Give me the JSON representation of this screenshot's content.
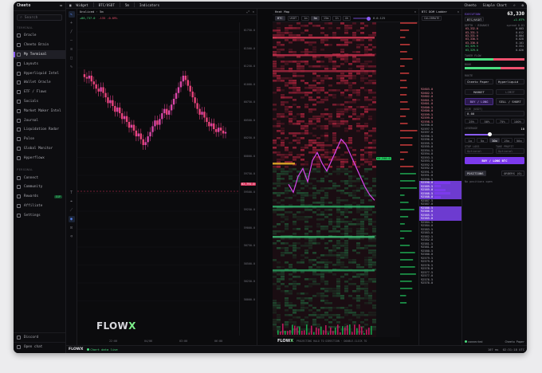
{
  "app": {
    "brand": "Cheeto",
    "status_brand": "FLOWX",
    "status_live": "Chart data live"
  },
  "sidebar": {
    "search_placeholder": "Search",
    "sections": {
      "terminal": "TERMINAL",
      "personal": "PERSONAL"
    },
    "items": [
      {
        "label": "Oracle"
      },
      {
        "label": "Cheeto Brain"
      },
      {
        "label": "My Terminal",
        "active": true
      },
      {
        "label": "Layouts"
      },
      {
        "label": "Hyperliquid Intel"
      },
      {
        "label": "Wallet Oracle"
      },
      {
        "label": "ETF / Flows"
      },
      {
        "label": "Socials"
      },
      {
        "label": "Market Maker Intel"
      },
      {
        "label": "Journal"
      },
      {
        "label": "Liquidation Radar"
      },
      {
        "label": "Pulse"
      },
      {
        "label": "Global Monitor"
      },
      {
        "label": "Hyperflowx"
      }
    ],
    "personal_items": [
      {
        "label": "Connect"
      },
      {
        "label": "Community"
      },
      {
        "label": "Rewards",
        "badge": "EXP"
      },
      {
        "label": "Affiliate"
      },
      {
        "label": "Settings"
      }
    ],
    "bottom": [
      {
        "label": "Discord"
      },
      {
        "label": "Open chat"
      }
    ]
  },
  "topbar": {
    "widget": "Widget",
    "symbol": "BTC/USDT",
    "interval": "5m",
    "indicators": "Indicators",
    "right": [
      "Cheeto",
      "Simple Chart"
    ]
  },
  "chart": {
    "title": "Unsliced · 5m",
    "legend_up": "+86,737.0",
    "legend_down": "-135 -0.09%",
    "price_label": "62,791.0",
    "y_ticks": [
      "61750.0",
      "61500.0",
      "61250.0",
      "61000.0",
      "60750.0",
      "60500.0",
      "60250.0",
      "60000.0",
      "59750.0",
      "59500.0",
      "59250.0",
      "59000.0",
      "58750.0",
      "58500.0",
      "58250.0",
      "58000.0"
    ],
    "x_ticks": [
      "22:00",
      "04/06",
      "03:00",
      "06:00"
    ],
    "series": [
      {
        "values": [
          61120,
          61080,
          61060,
          61100,
          61020,
          60980,
          60920,
          60880,
          60940,
          60860,
          60800,
          60720,
          60760,
          60680,
          60600,
          60660,
          60580,
          60500,
          60540,
          60460,
          60380,
          60420,
          60340,
          60260,
          60300,
          60220,
          60140,
          60180,
          60260,
          60320,
          60400,
          60480,
          60420,
          60500,
          60580,
          60640,
          60560,
          60620,
          60700,
          60780,
          60860,
          60940,
          61020,
          61100,
          61040,
          60960,
          60880,
          60800,
          60720,
          60640,
          60560,
          60600,
          60520,
          60460,
          60400,
          60440,
          60360,
          60320,
          60380,
          60340,
          60300,
          60320
        ]
      }
    ]
  },
  "heatmap": {
    "title": "Heat Map",
    "pair": "BTC",
    "quote": "USDT",
    "intervals": [
      "1m",
      "5m",
      "15m",
      "1h",
      "4h"
    ],
    "selected_interval": "5m",
    "range_label": "0.0-125",
    "price_label": "60,340.0",
    "footer": "PROJECTING HALO TO DIRECTION · DOUBLE-CLICK TO"
  },
  "dom": {
    "title": "BTC DOM Ladder",
    "button": "CALIBRATE",
    "rows": [
      "92603.0",
      "92602.5",
      "92602.0",
      "92601.5",
      "92601.0",
      "92600.5",
      "92600.0",
      "92599.5",
      "92599.0",
      "92598.5",
      "92598.0",
      "92597.5",
      "92597.0",
      "92596.5",
      "92596.0",
      "92595.5",
      "92595.0",
      "92594.5",
      "92594.0",
      "92593.5",
      "92593.0",
      "92592.5",
      "92592.0",
      "92591.5",
      "92591.0",
      "92590.5",
      "92590.0",
      "92589.5",
      "92589.0",
      "92588.5",
      "92588.0",
      "92587.5",
      "92587.0",
      "92586.5",
      "92586.0",
      "92585.5",
      "92585.0",
      "92584.5",
      "92584.0",
      "92583.5",
      "92583.0",
      "92582.5",
      "92582.0",
      "92581.5",
      "92581.0",
      "92580.5",
      "92580.0",
      "92579.5",
      "92579.0",
      "92578.5",
      "92578.0",
      "92577.5",
      "92577.0",
      "92576.5",
      "92576.0"
    ],
    "footer_left": "107 ms",
    "footer_right": "02:31:18 UTC"
  },
  "trade": {
    "title": "EXECUTION",
    "price": "63,330",
    "pair": "BTC/USDT",
    "change": "+1.67%",
    "depth_title": "DEPTH · BINANCE",
    "spread": "spread 0.01",
    "asks": [
      [
        "63,332.0",
        "0.003"
      ],
      [
        "63,331.5",
        "0.012"
      ],
      [
        "63,331.0",
        "0.004"
      ],
      [
        "63,330.5",
        "0.028"
      ],
      [
        "63,330.0",
        "0.101"
      ]
    ],
    "bids": [
      [
        "63,329.5",
        "0.331"
      ],
      [
        "63,329.0",
        "0.026"
      ]
    ],
    "flow_label": "TAKER FLOW",
    "book_label": "BOOK",
    "route_label": "ROUTE",
    "route_value": "Cheeto Paper",
    "route_alt": "Hyperliquid",
    "order_types": [
      "MARKET",
      "LIMIT"
    ],
    "sides": [
      "BUY / LONG",
      "SELL / SHORT"
    ],
    "size_label": "SIZE (USDT)",
    "size_value": "0.00",
    "pct": [
      "25%",
      "50%",
      "75%",
      "100%"
    ],
    "leverage_label": "LEVERAGE",
    "leverage_value": "10",
    "lev_opts": [
      "1x",
      "5x",
      "10x",
      "25x",
      "50x"
    ],
    "selected_lev": "10x",
    "sl_label": "STOP LOSS",
    "tp_label": "TAKE PROFIT",
    "sl_placeholder": "Optional",
    "tp_placeholder": "Optional",
    "cta": "BUY / LONG BTC",
    "note": "No positions open",
    "positions_tab": "POSITIONS",
    "orders_tab": "ORDERS (0)",
    "footer_left": "connected",
    "footer_right": "Cheeto Paper"
  },
  "colors": {
    "accent": "#7c3aed",
    "up": "#4ade80",
    "down": "#f0506e",
    "candle": "#e6409c"
  }
}
